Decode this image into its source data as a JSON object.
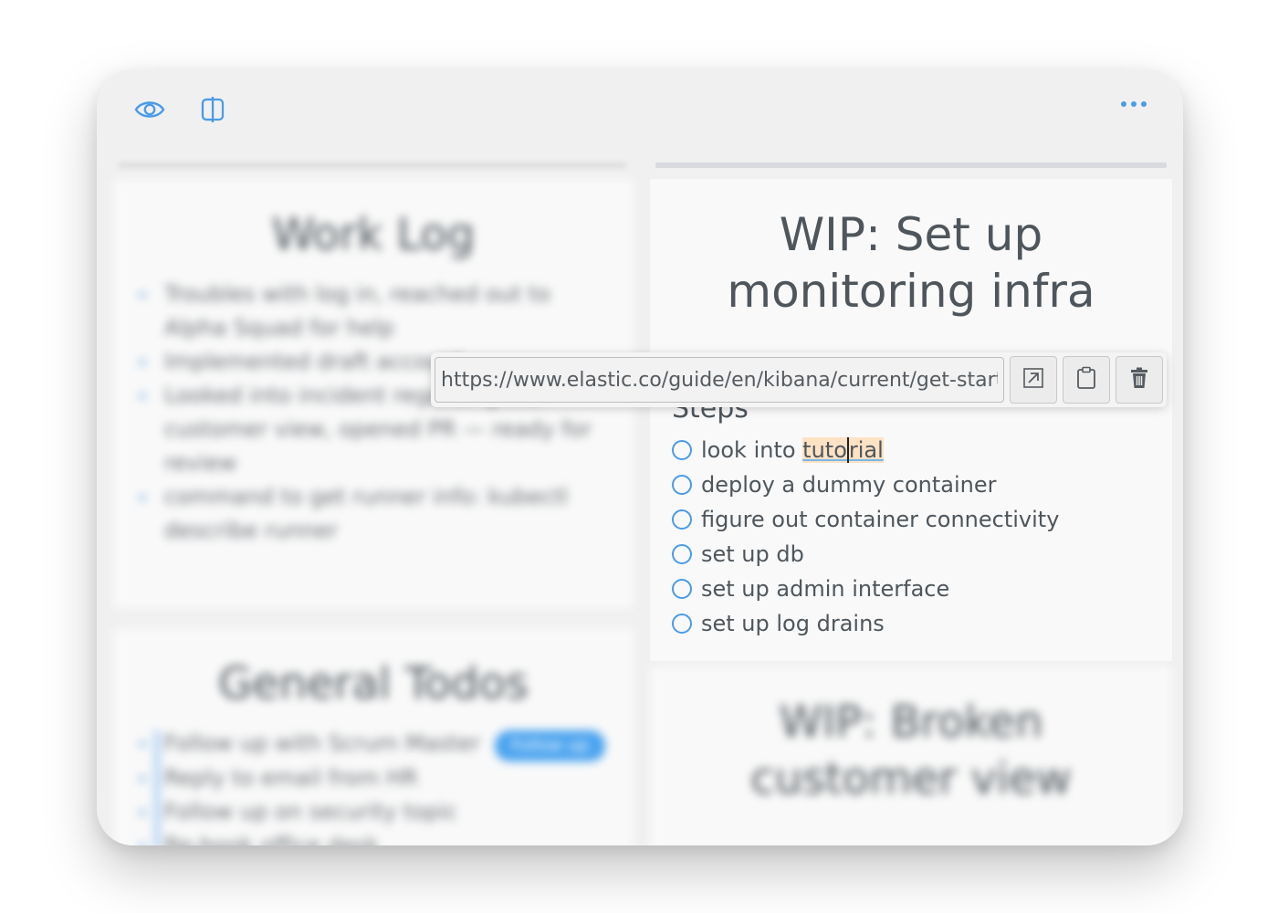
{
  "toolbar": {
    "left_icons": [
      "eye-icon",
      "split-view-icon"
    ],
    "right_icon": "more-icon",
    "accent_color": "#4a9be8"
  },
  "background_cards": {
    "work_log": {
      "title": "Work Log",
      "items": [
        "Troubles with log in, reached out to Alpha Squad for help",
        "Implemented draft account",
        "Looked into incident regarding the customer view, opened PR — ready for review",
        "command to get runner info: kubectl describe runner"
      ]
    },
    "general_todos": {
      "title": "General Todos",
      "items": [
        "Follow up with Scrum Master",
        "Reply to email from HR",
        "Follow up on security topic",
        "Re-book office desk"
      ],
      "pill": "Follow up"
    },
    "broken_view": {
      "title": "WIP: Broken customer view"
    }
  },
  "focus_card": {
    "title": "WIP: Set up monitoring infra",
    "steps_heading": "Steps",
    "tasks": [
      {
        "label": "look into ",
        "highlight_before": "tuto",
        "highlight_after": "rial",
        "checked": false
      },
      {
        "label": "deploy a dummy container",
        "checked": false
      },
      {
        "label": "figure out container connectivity",
        "checked": false
      },
      {
        "label": "set up db",
        "checked": false
      },
      {
        "label": "set up admin interface",
        "checked": false
      },
      {
        "label": "set up log drains",
        "checked": false
      }
    ]
  },
  "link_popup": {
    "url": "https://www.elastic.co/guide/en/kibana/current/get-started.html",
    "buttons": [
      "open-link-icon",
      "clipboard-icon",
      "trash-icon"
    ]
  }
}
